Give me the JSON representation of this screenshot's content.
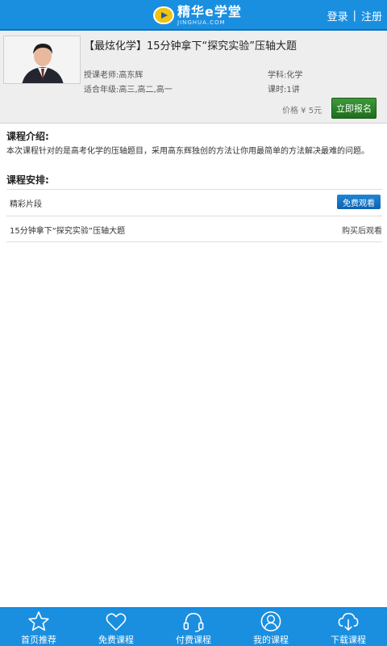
{
  "header": {
    "logo_cn": "精华e学堂",
    "logo_en": "JINGHUA.COM",
    "login": "登录",
    "separator": "|",
    "register": "注册"
  },
  "course": {
    "title": "【最炫化学】15分钟拿下“探究实验”压轴大题",
    "teacher": "授课老师:高东辉",
    "grade": "适合年级:高三,高二,高一",
    "subject": "学科:化学",
    "hours": "课时:1讲",
    "price": "价格 ¥ 5元",
    "enroll_label": "立即报名"
  },
  "intro": {
    "title": "课程介绍:",
    "text": "本次课程针对的是高考化学的压轴题目，采用高东辉独创的方法让你用最简单的方法解决最难的问题。"
  },
  "schedule": {
    "title": "课程安排:",
    "lessons": [
      {
        "name": "精彩片段",
        "action": "免费观看"
      },
      {
        "name": "15分钟拿下“探究实验”压轴大题",
        "action": "购买后观看"
      }
    ]
  },
  "nav": {
    "items": [
      {
        "label": "首页推荐",
        "icon": "star-icon"
      },
      {
        "label": "免费课程",
        "icon": "heart-icon"
      },
      {
        "label": "付费课程",
        "icon": "headphones-icon"
      },
      {
        "label": "我的课程",
        "icon": "user-icon"
      },
      {
        "label": "下载课程",
        "icon": "cloud-download-icon"
      }
    ]
  },
  "colors": {
    "brand_blue": "#1a8fe0",
    "enroll_green": "#2e8a2b",
    "free_blue": "#1478c8"
  }
}
